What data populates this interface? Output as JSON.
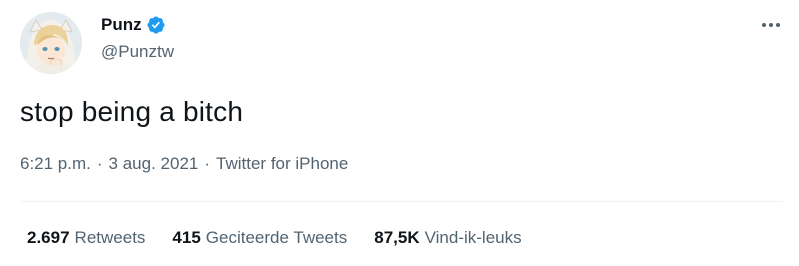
{
  "user": {
    "display_name": "Punz",
    "handle": "@Punztw",
    "verified": true,
    "verified_icon": "verified-badge-icon",
    "verified_color": "#1d9bf0",
    "avatar_icon": "avatar-image"
  },
  "tweet": {
    "text": "stop being a bitch",
    "time": "6:21 p.m.",
    "date": "3 aug. 2021",
    "separator": "·",
    "source": "Twitter for iPhone"
  },
  "stats": {
    "retweets_count": "2.697",
    "retweets_label": "Retweets",
    "quotes_count": "415",
    "quotes_label": "Geciteerde Tweets",
    "likes_count": "87,5K",
    "likes_label": "Vind-ik-leuks"
  },
  "menu": {
    "more_icon": "more-horizontal-icon"
  },
  "colors": {
    "text_primary": "#0f1419",
    "text_secondary": "#536471",
    "divider": "#eff3f4",
    "accent": "#1d9bf0"
  }
}
